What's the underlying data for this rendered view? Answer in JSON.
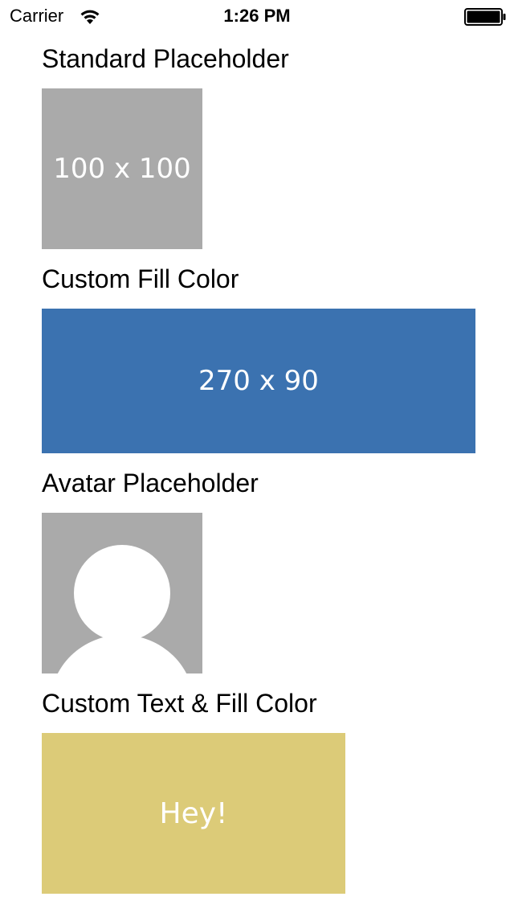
{
  "status_bar": {
    "carrier": "Carrier",
    "time": "1:26 PM",
    "wifi_icon": "wifi-icon",
    "battery_icon": "battery-icon"
  },
  "sections": {
    "standard": {
      "label": "Standard Placeholder",
      "text": "100 x 100",
      "fill": "#aaaaaa"
    },
    "custom_fill": {
      "label": "Custom Fill Color",
      "text": "270 x 90",
      "fill": "#3b72b0"
    },
    "avatar": {
      "label": "Avatar Placeholder",
      "fill": "#aaaaaa",
      "icon": "avatar-silhouette-icon"
    },
    "custom_text": {
      "label": "Custom Text & Fill Color",
      "text": "Hey!",
      "fill": "#dccb78"
    }
  }
}
